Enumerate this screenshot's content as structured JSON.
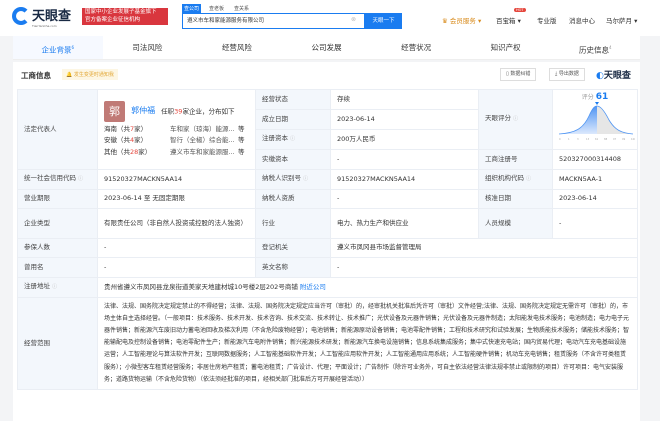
{
  "header": {
    "logo": "天眼查",
    "logo_sub": "TianYanCha.com",
    "banner": [
      "国家中小企业发展子基金旗下",
      "官方备案企业征信机构"
    ],
    "search_tabs": [
      "查公司",
      "查老板",
      "查关系"
    ],
    "search_value": "遵义市车和家能源服务有限公司",
    "search_button": "天眼一下",
    "nav": {
      "vip": "会员服务",
      "box": "百宝箱",
      "hot": "HOT",
      "pro": "专业版",
      "msg": "消息中心",
      "user": "马尔萨月"
    }
  },
  "tabs": [
    {
      "label": "企业背景",
      "count": "6"
    },
    {
      "label": "司法风险"
    },
    {
      "label": "经营风险"
    },
    {
      "label": "公司发展"
    },
    {
      "label": "经营状况"
    },
    {
      "label": "知识产权"
    },
    {
      "label": "历史信息",
      "count": "4"
    }
  ],
  "section": {
    "title": "工商信息",
    "notice": "发生变更时通知我",
    "btn_error": "数据纠错",
    "btn_export": "导出数据",
    "watermark": "天眼查"
  },
  "rep": {
    "label": "法定代表人",
    "avatar": "郭",
    "name": "郭仲福",
    "pre": "任职",
    "count": "39",
    "post": "家企业，分布如下",
    "regions": [
      {
        "r": "海南（共",
        "n": "7",
        "s": "家）",
        "c": "车和家（琼海）能源...",
        "e": "等"
      },
      {
        "r": "安徽（共",
        "n": "4",
        "s": "家）",
        "c": "智行（全椒）综合能...",
        "e": "等"
      },
      {
        "r": "其他（共",
        "n": "28",
        "s": "家）",
        "c": "遵义市车和家能源服...",
        "e": "等"
      }
    ]
  },
  "fields": {
    "status": [
      "经营状态",
      "存续"
    ],
    "founded": [
      "成立日期",
      "2023-06-14"
    ],
    "capital": [
      "注册资本",
      "200万人民币"
    ],
    "paid": [
      "实缴资本",
      "-"
    ],
    "score": {
      "label": "天眼评分",
      "title": "评分",
      "value": "61",
      "ticks": [
        "0",
        "1",
        "3",
        "13",
        "61",
        "88",
        "97",
        "99",
        "100"
      ]
    },
    "regno": [
      "工商注册号",
      "520327000314408"
    ],
    "credit": [
      "统一社会信用代码",
      "91520327MACKN5AA14"
    ],
    "taxid": [
      "纳税人识别号",
      "91520327MACKN5AA14"
    ],
    "org": [
      "组织机构代码",
      "MACKN5AA-1"
    ],
    "term": [
      "营业期限",
      "2023-06-14 至 无固定期限"
    ],
    "taxq": [
      "纳税人资质",
      "-"
    ],
    "approve": [
      "核准日期",
      "2023-06-14"
    ],
    "type": [
      "企业类型",
      "有限责任公司（非自然人投资或控股的法人独资）"
    ],
    "industry": [
      "行业",
      "电力、热力生产和供应业"
    ],
    "staff": [
      "人员规模",
      "-"
    ],
    "insured": [
      "参保人数",
      "-"
    ],
    "authority": [
      "登记机关",
      "遵义市凤冈县市场监督管理局"
    ],
    "former": [
      "曾用名",
      "-"
    ],
    "english": [
      "英文名称",
      "-"
    ],
    "address": [
      "注册地址",
      "贵州省遵义市凤冈县龙泉街道美家天地建材城10号楼2层202号商铺",
      "附近公司"
    ],
    "scope": [
      "经营范围",
      "法律、法规、国务院决定规定禁止的不得经营；法律、法规、国务院决定规定应当许可（审批）的，经审批机关批准后凭许可（审批）文件经营;法律、法规、国务院决定规定无需许可（审批）的，市场主体自主选择经营。（一般项目：技术服务、技术开发、技术咨询、技术交流、技术转让、技术推广；光伏设备及元器件销售；光伏设备及元器件制造；太阳能发电技术服务；电池制造；电力电子元器件销售；新能源汽车废旧动力蓄电池回收及梯次利用（不含危险废物经营）；电池销售；新能源原动设备销售；电池零配件销售；工程和技术研究和试验发展；生物质能技术服务；储能技术服务；智能输配电及控制设备销售；电池零配件生产；新能源汽车电附件销售；新兴能源技术研发；新能源汽车换电设施销售；信息系统集成服务；集中式快速充电站；国内贸易代理；电动汽车充电基础设施运营；人工智能理论与算法软件开发；互联网数据服务；人工智能基础软件开发；人工智能应用软件开发；人工智能通用应用系统；人工智能硬件销售；机动车充电销售；租赁服务（不含许可类租赁服务）；小微型客车租赁经营服务；非居住房地产租赁；蓄电池租赁；广告设计、代理；平面设计；广告制作（除许可业务外，可自主依法经营法律法规非禁止或限制的项目）许可项目：电气安装服务；道路货物运输（不含危险货物）（依法须经批准的项目，经相关部门批准后方可开展经营活动））"
    ]
  },
  "colors": {
    "accent": "#1a7cf0",
    "red": "#e5463c",
    "label_bg": "#f3f7fc"
  }
}
